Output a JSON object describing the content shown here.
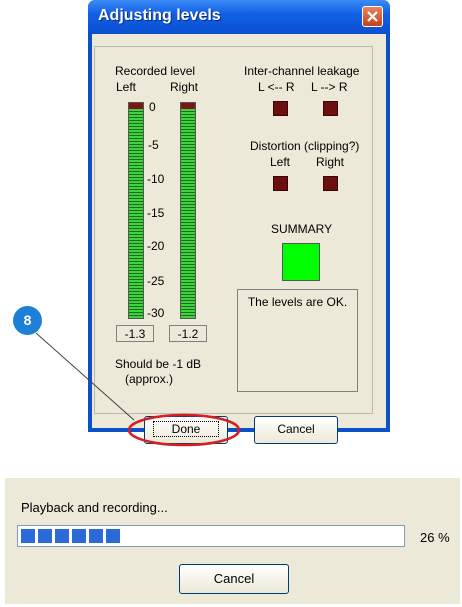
{
  "dialog": {
    "title": "Adjusting levels",
    "recorded_level": {
      "heading": "Recorded level",
      "left_label": "Left",
      "right_label": "Right",
      "scale": [
        "0",
        "-5",
        "-10",
        "-15",
        "-20",
        "-25",
        "-30"
      ],
      "left_value": "-1.3",
      "right_value": "-1.2",
      "hint_line1": "Should be  -1 dB",
      "hint_line2": "(approx.)"
    },
    "leakage": {
      "heading": "Inter-channel leakage",
      "l_from_r": "L <-- R",
      "l_to_r": "L --> R"
    },
    "distortion": {
      "heading": "Distortion (clipping?)",
      "left_label": "Left",
      "right_label": "Right"
    },
    "summary": {
      "heading": "SUMMARY",
      "message": "The levels are OK.",
      "color": "#00ff00"
    },
    "done_label": "Done",
    "cancel_label": "Cancel"
  },
  "annotation": {
    "number": "8",
    "highlight_color": "#d42020"
  },
  "progress_dialog": {
    "status": "Playback and recording...",
    "percent": 26,
    "percent_text": "26 %",
    "cancel_label": "Cancel"
  }
}
